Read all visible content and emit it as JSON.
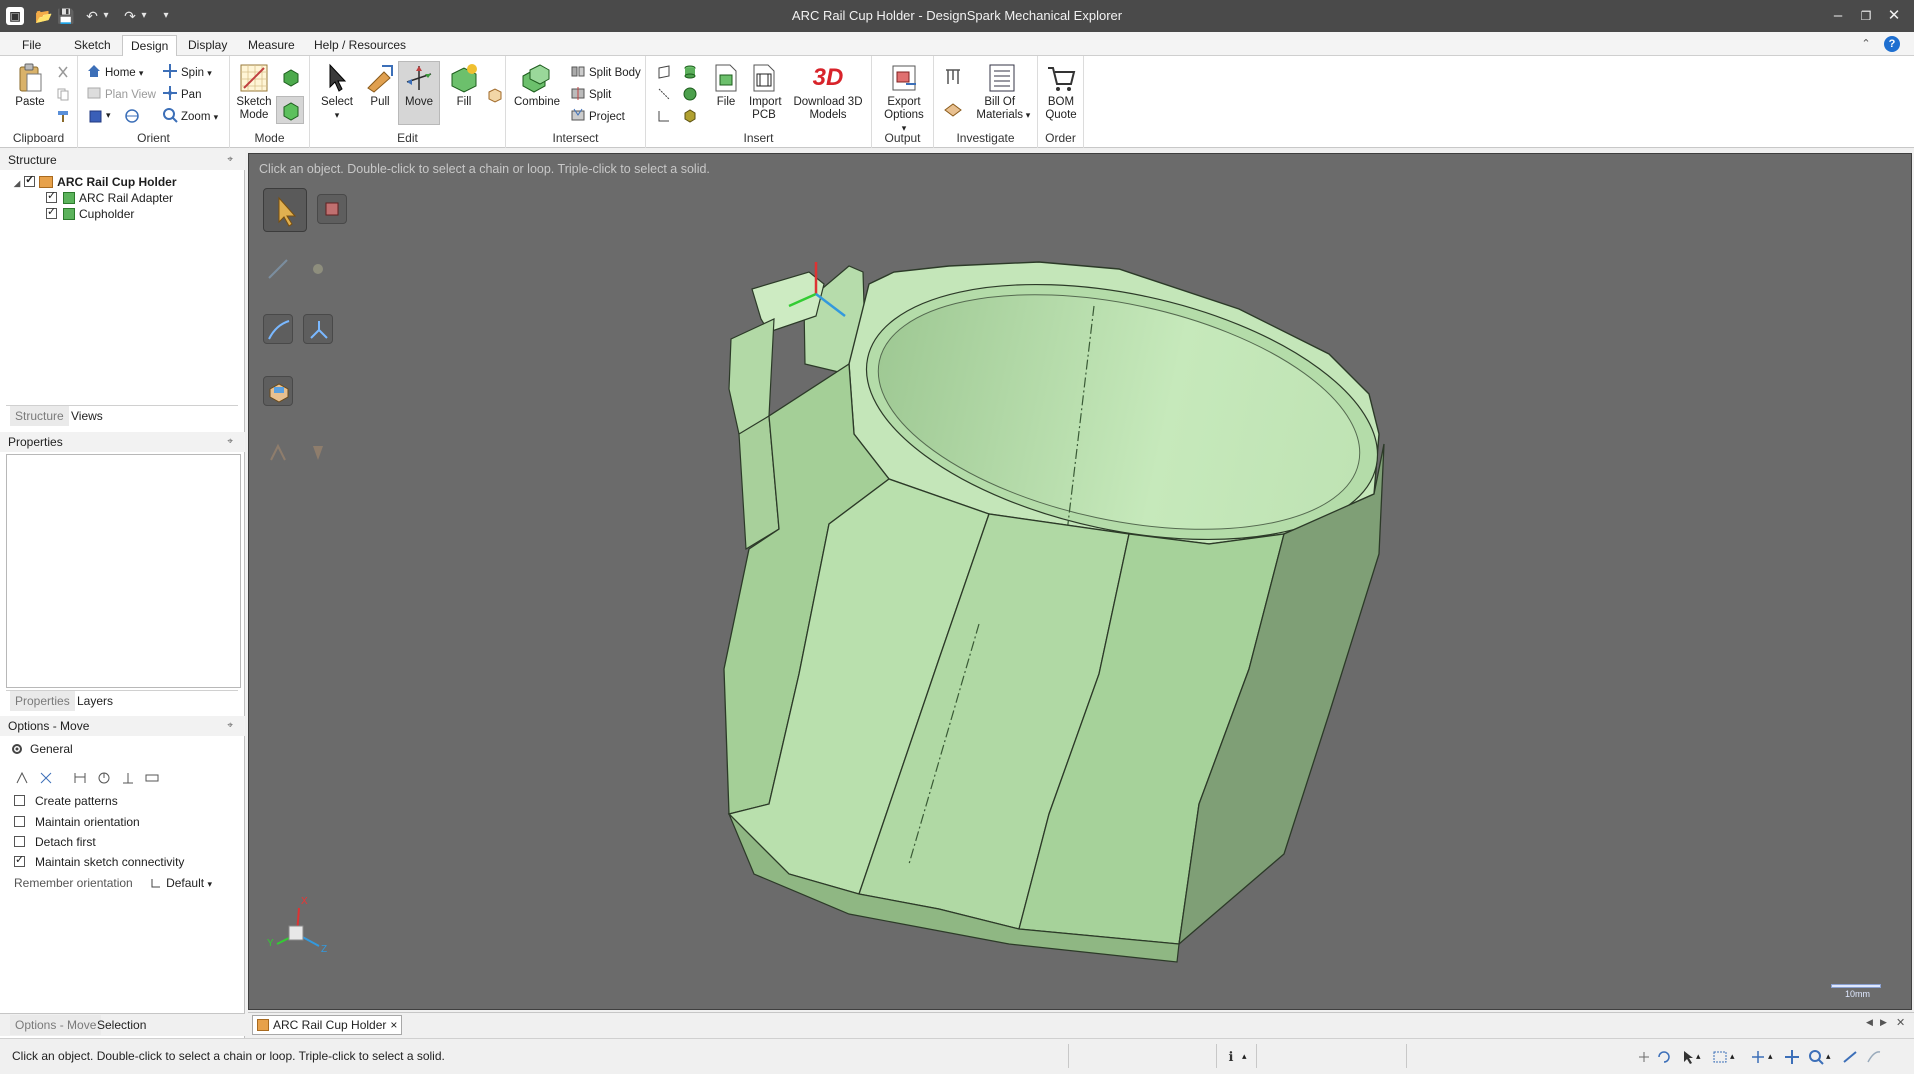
{
  "window": {
    "title": "ARC Rail Cup Holder - DesignSpark Mechanical Explorer",
    "minimize_glyph": "–",
    "restore_glyph": "❐",
    "close_glyph": "✕"
  },
  "quick_access": {
    "app_icon_glyph": "▣",
    "open_glyph": "📂",
    "save_glyph": "💾",
    "undo_glyph": "↶",
    "redo_glyph": "↷",
    "dropdown_glyph": "▾"
  },
  "ribbon_tabs": [
    {
      "label": "File",
      "active": false
    },
    {
      "label": "Sketch",
      "active": false
    },
    {
      "label": "Design",
      "active": true
    },
    {
      "label": "Display",
      "active": false
    },
    {
      "label": "Measure",
      "active": false
    },
    {
      "label": "Help / Resources",
      "active": false
    }
  ],
  "ribbon_right": {
    "collapse_glyph": "⌃",
    "help_glyph": "?"
  },
  "ribbon": {
    "clipboard": {
      "label": "Clipboard",
      "paste": "Paste"
    },
    "orient": {
      "label": "Orient",
      "home": "Home",
      "spin": "Spin",
      "plan_view": "Plan View",
      "pan": "Pan",
      "zoom": "Zoom"
    },
    "mode": {
      "label": "Mode",
      "sketch_mode": "Sketch Mode"
    },
    "edit": {
      "label": "Edit",
      "select": "Select",
      "pull": "Pull",
      "move": "Move",
      "fill": "Fill"
    },
    "intersect": {
      "label": "Intersect",
      "combine": "Combine",
      "split_body": "Split Body",
      "split": "Split",
      "project": "Project"
    },
    "insert": {
      "label": "Insert",
      "file": "File",
      "import_pcb": "Import PCB",
      "download_3d": "Download 3D Models",
      "download_3d_badge": "3D"
    },
    "output": {
      "label": "Output",
      "export_options": "Export Options"
    },
    "investigate": {
      "label": "Investigate",
      "bill_of_materials": "Bill Of Materials"
    },
    "order": {
      "label": "Order",
      "bom_quote": "BOM Quote"
    }
  },
  "structure_panel": {
    "header": "Structure",
    "pin_glyph": "⌖",
    "tree": [
      {
        "label": "ARC Rail Cup Holder",
        "checked": true,
        "level": 0,
        "bold": true
      },
      {
        "label": "ARC Rail Adapter",
        "checked": true,
        "level": 1,
        "bold": false
      },
      {
        "label": "Cupholder",
        "checked": true,
        "level": 1,
        "bold": false
      }
    ],
    "expand_glyph": "◢",
    "tabs": [
      "Structure",
      "Views"
    ]
  },
  "properties_panel": {
    "header": "Properties",
    "tabs": [
      "Properties",
      "Layers"
    ]
  },
  "options_panel": {
    "header": "Options - Move",
    "section": "General",
    "options": [
      {
        "label": "Create patterns",
        "checked": false
      },
      {
        "label": "Maintain orientation",
        "checked": false
      },
      {
        "label": "Detach first",
        "checked": false
      },
      {
        "label": "Maintain sketch connectivity",
        "checked": true
      }
    ],
    "remember_orientation_label": "Remember orientation",
    "remember_orientation_value": "Default"
  },
  "bottom_left_tabs": [
    "Options - Move",
    "Selection"
  ],
  "viewport": {
    "hint": "Click an object.  Double-click to select a chain or loop.  Triple-click to select a solid.",
    "axis_x": "X",
    "axis_y": "Y",
    "axis_z": "Z",
    "scale_label": "10mm",
    "model_color": "#bfe3b4",
    "background": "#6b6b6b"
  },
  "document_tabs": [
    {
      "label": "ARC Rail Cup Holder",
      "close": "×"
    }
  ],
  "doc_nav": {
    "prev": "◀",
    "next": "▶",
    "close": "✕"
  },
  "status_bar": {
    "text": "Click an object.  Double-click to select a chain or loop.  Triple-click to select a solid.",
    "info_glyph": "ℹ"
  }
}
